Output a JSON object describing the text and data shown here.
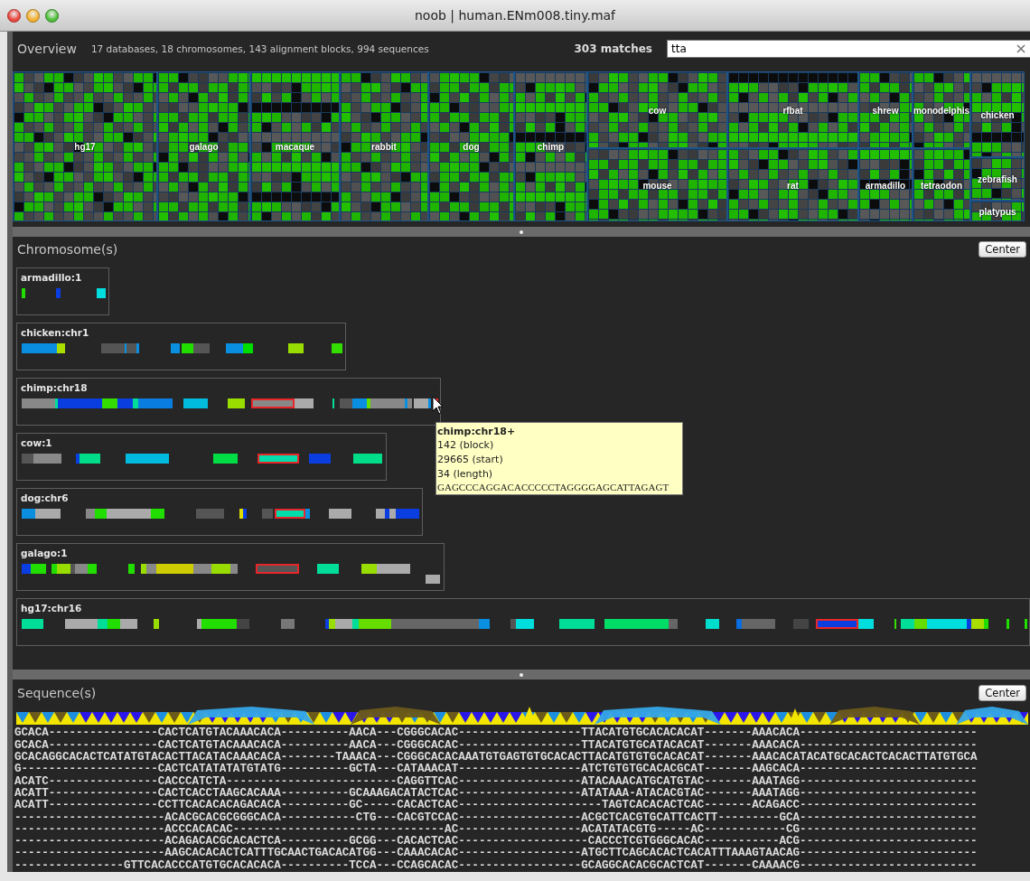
{
  "window": {
    "title": "noob | human.ENm008.tiny.maf"
  },
  "overview": {
    "title": "Overview",
    "summary": "17 databases, 18 chromosomes, 143 alignment blocks, 994 sequences",
    "matches": "303 matches",
    "search": {
      "value": "tta"
    },
    "tiles": [
      {
        "label": "hg17"
      },
      {
        "label": "galago"
      },
      {
        "label": "macaque"
      },
      {
        "label": "rabbit"
      },
      {
        "label": "dog"
      },
      {
        "label": "chimp"
      },
      {
        "label": "cow"
      },
      {
        "label": "mouse"
      },
      {
        "label": "rfbat"
      },
      {
        "label": "rat"
      },
      {
        "label": "shrew"
      },
      {
        "label": "armadillo"
      },
      {
        "label": "monodelphis"
      },
      {
        "label": "tetraodon"
      },
      {
        "label": "chicken"
      },
      {
        "label": "zebrafish"
      },
      {
        "label": "platypus"
      }
    ]
  },
  "chromosomes": {
    "title": "Chromosome(s)",
    "center_button": "Center",
    "tracks": [
      {
        "label": "armadillo:1",
        "segments": [
          {
            "color": "#22dd00",
            "selected": false
          },
          {
            "color": "#0a3ee0",
            "selected": false
          },
          {
            "color": "#00dddd",
            "selected": false
          }
        ]
      },
      {
        "label": "chicken:chr1",
        "segments": [
          {
            "color": "#0a8ee0",
            "selected": false
          },
          {
            "color": "#aadd00",
            "selected": false
          },
          {
            "color": "#555555",
            "selected": false
          },
          {
            "color": "#0a8ee0",
            "selected": false
          },
          {
            "color": "#555555",
            "selected": false
          },
          {
            "color": "#0a8ee0",
            "selected": false
          },
          {
            "color": "#0a8ee0",
            "selected": false
          },
          {
            "color": "#22dd00",
            "selected": false
          },
          {
            "color": "#555555",
            "selected": false
          },
          {
            "color": "#0a8ee0",
            "selected": false
          },
          {
            "color": "#00dd00",
            "selected": false
          },
          {
            "color": "#99dd00",
            "selected": false
          },
          {
            "color": "#33dd00",
            "selected": false
          }
        ]
      },
      {
        "label": "chimp:chr18",
        "segments": [
          {
            "color": "#888888",
            "selected": false
          },
          {
            "color": "#00dd99",
            "selected": false
          },
          {
            "color": "#0a3ee0",
            "selected": false
          },
          {
            "color": "#33dd00",
            "selected": false
          },
          {
            "color": "#0a3ee0",
            "selected": false
          },
          {
            "color": "#00dd99",
            "selected": false
          },
          {
            "color": "#0a7ee0",
            "selected": false
          },
          {
            "color": "#00bbdd",
            "selected": false
          },
          {
            "color": "#99dd00",
            "selected": false
          },
          {
            "color": "#888888",
            "selected": true
          },
          {
            "color": "#aaaaaa",
            "selected": false
          },
          {
            "color": "#00dd99",
            "selected": false
          },
          {
            "color": "#555555",
            "selected": false
          },
          {
            "color": "#0a8ee0",
            "selected": false
          },
          {
            "color": "#66dd00",
            "selected": false
          },
          {
            "color": "#888888",
            "selected": false
          },
          {
            "color": "#0a8ee0",
            "selected": false
          },
          {
            "color": "#888888",
            "selected": false
          },
          {
            "color": "#aaaaaa",
            "selected": false
          },
          {
            "color": "#0a8ee0",
            "selected": false
          },
          {
            "color": "#888888",
            "selected": true
          }
        ]
      },
      {
        "label": "cow:1",
        "segments": [
          {
            "color": "#555555",
            "selected": false
          },
          {
            "color": "#888888",
            "selected": false
          },
          {
            "color": "#0a3ee0",
            "selected": false
          },
          {
            "color": "#00dd88",
            "selected": false
          },
          {
            "color": "#00bbdd",
            "selected": false
          },
          {
            "color": "#00dd44",
            "selected": false
          },
          {
            "color": "#00ddaa",
            "selected": true
          },
          {
            "color": "#0a3ee0",
            "selected": false
          },
          {
            "color": "#00dd88",
            "selected": false
          }
        ]
      },
      {
        "label": "dog:chr6",
        "segments": [
          {
            "color": "#0a8ee0",
            "selected": false
          },
          {
            "color": "#aaaaaa",
            "selected": false
          },
          {
            "color": "#888888",
            "selected": false
          },
          {
            "color": "#22dd00",
            "selected": false
          },
          {
            "color": "#aaaaaa",
            "selected": false
          },
          {
            "color": "#22dd00",
            "selected": false
          },
          {
            "color": "#555555",
            "selected": false
          },
          {
            "color": "#dddd00",
            "selected": false
          },
          {
            "color": "#0a3ee0",
            "selected": false
          },
          {
            "color": "#555555",
            "selected": false
          },
          {
            "color": "#00ddaa",
            "selected": true
          },
          {
            "color": "#0a8ee0",
            "selected": false
          },
          {
            "color": "#aaaaaa",
            "selected": false
          },
          {
            "color": "#aaaaaa",
            "selected": false
          },
          {
            "color": "#0a3ee0",
            "selected": false
          },
          {
            "color": "#aaaaaa",
            "selected": false
          },
          {
            "color": "#0a3ee0",
            "selected": false
          }
        ]
      },
      {
        "label": "galago:1",
        "segments": [
          {
            "color": "#0a3ee0",
            "selected": false
          },
          {
            "color": "#22dd00",
            "selected": false
          },
          {
            "color": "#22dd00",
            "selected": false
          },
          {
            "color": "#99dd00",
            "selected": false
          },
          {
            "color": "#555555",
            "selected": false
          },
          {
            "color": "#888888",
            "selected": false
          },
          {
            "color": "#22dd00",
            "selected": false
          },
          {
            "color": "#22dd00",
            "selected": false
          },
          {
            "color": "#99dd00",
            "selected": false
          },
          {
            "color": "#888888",
            "selected": false
          },
          {
            "color": "#cccc00",
            "selected": false
          },
          {
            "color": "#888888",
            "selected": false
          },
          {
            "color": "#99dd00",
            "selected": false
          },
          {
            "color": "#888888",
            "selected": false
          },
          {
            "color": "#555555",
            "selected": true
          },
          {
            "color": "#00dd99",
            "selected": false
          },
          {
            "color": "#99dd00",
            "selected": false
          },
          {
            "color": "#aaaaaa",
            "selected": false
          },
          {
            "color": "#aaaaaa",
            "selected": false
          }
        ]
      },
      {
        "label": "hg17:chr16",
        "segments": [
          {
            "color": "#00dd99",
            "selected": false
          },
          {
            "color": "#aaaaaa",
            "selected": false
          },
          {
            "color": "#00dd99",
            "selected": false
          },
          {
            "color": "#22dd00",
            "selected": false
          },
          {
            "color": "#aaaaaa",
            "selected": false
          },
          {
            "color": "#99dd00",
            "selected": false
          },
          {
            "color": "#aaaaaa",
            "selected": false
          },
          {
            "color": "#22dd00",
            "selected": false
          },
          {
            "color": "#444444",
            "selected": false
          },
          {
            "color": "#777777",
            "selected": false
          },
          {
            "color": "#0a3ee0",
            "selected": false
          },
          {
            "color": "#99dd00",
            "selected": false
          },
          {
            "color": "#aaaaaa",
            "selected": false
          },
          {
            "color": "#00dd99",
            "selected": false
          },
          {
            "color": "#66dd00",
            "selected": false
          },
          {
            "color": "#666666",
            "selected": false
          },
          {
            "color": "#0a8ee0",
            "selected": false
          },
          {
            "color": "#555555",
            "selected": false
          },
          {
            "color": "#00dddd",
            "selected": false
          },
          {
            "color": "#00dd99",
            "selected": false
          },
          {
            "color": "#00dd66",
            "selected": false
          },
          {
            "color": "#666666",
            "selected": false
          },
          {
            "color": "#00ddcc",
            "selected": false
          },
          {
            "color": "#0a6ee0",
            "selected": false
          },
          {
            "color": "#666666",
            "selected": false
          },
          {
            "color": "#444444",
            "selected": false
          },
          {
            "color": "#0a3ee0",
            "selected": true
          },
          {
            "color": "#00dddd",
            "selected": false
          },
          {
            "color": "#33dd00",
            "selected": false
          },
          {
            "color": "#00dd99",
            "selected": false
          },
          {
            "color": "#66dd00",
            "selected": false
          },
          {
            "color": "#00dddd",
            "selected": false
          },
          {
            "color": "#0a3ee0",
            "selected": false
          },
          {
            "color": "#aadd00",
            "selected": false
          },
          {
            "color": "#22dd00",
            "selected": false
          },
          {
            "color": "#22dd00",
            "selected": false
          },
          {
            "color": "#22dd00",
            "selected": false
          }
        ]
      }
    ]
  },
  "tooltip": {
    "title": "chimp:chr18+",
    "lines": [
      "142 (block)",
      "29665 (start)",
      "34 (length)"
    ],
    "sequence": "GAGCCCAGGACACCCCCTAGGGGAGCATTAGAGT"
  },
  "sequences": {
    "title": "Sequence(s)",
    "center_button": "Center",
    "lines": [
      "GCACA----------------CACTCATGTACAAACACA----------AACA---CGGGCACAC------------------TTACATGTGCACACACAT-------AAACACA--------------------------",
      "GCACA----------------CACTCATGTACAAACACA----------AACA---CGGGCACAC------------------TTACATGTGCATACACAT-------AAACACA--------------------------",
      "GCACAGGCACACTCATATGTACACTTACATACAAACACA--------TAAACA---CGGGCACACAAATGTGAGTGTGCACACTTACATGTGTGCACACAT-------AAACACATACATGCACACTCACACTTATGTGCA",
      "G--------------------CACTCATATATATGTATG----------GCTA---CATAAACAT------------------ATCTGTGTGCACACGCAT-------AAGCACA--------------------------",
      "ACATC----------------CACCCATCTA-------------------------CAGGTTCAC------------------ATACAAACATGCATGTAC-------AAATAGG--------------------------",
      "ACATT----------------CACTCACCTAAGCACAAA----------GCAAAGACATACTCAC------------------ATATAAA-ATACACGTAC-------AAATAGG--------------------------",
      "ACATT----------------CCTTCACACACAGACACA----------GC-----CACACTCAC---------------------TAGTCACACACTCAC-------ACAGACC--------------------------",
      "----------------------ACACGCACGCGGGCACA-----------CTG---CACGTCCAC------------------ACGCTCACGTGCATTCACTT---------GCA--------------------------",
      "----------------------ACCCACACAC-------------------------------AC------------------ACATATACGTG-----AC------------CG--------------------------",
      "----------------------ACAGACACGCACACTCA----------GCGG---CACACTCAC-------------------CACCCTCGTGGGCACAC-----------ACG--------------------------",
      "----------------------AAGCACACACTCATTTGCAACTGACACATGG---CAAACACAC------------------ATGCTTCAGCACACTCACATTTAAAGTAACAG--------------------------",
      "----------------GTTCACACCCATGTGCACACACA----------TCCA---CCAGCACAC------------------GCAGGCACACGCACTCAT-------CAAAACG--------------------------"
    ]
  }
}
